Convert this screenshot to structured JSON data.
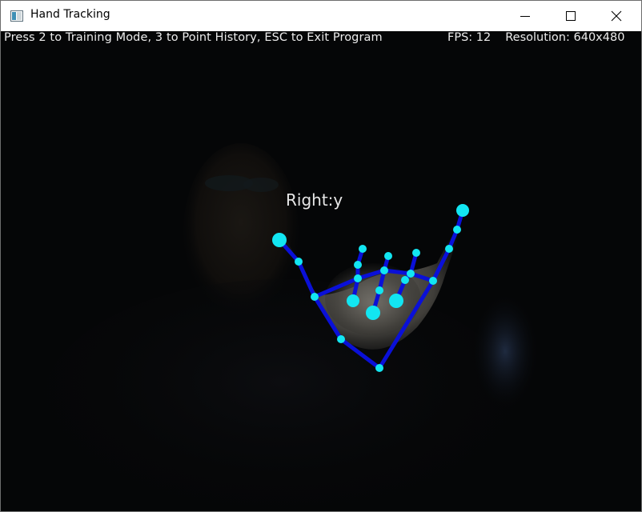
{
  "window": {
    "title": "Hand Tracking",
    "controls": [
      "minimize",
      "maximize",
      "close"
    ]
  },
  "hud": {
    "instructions": "Press 2 to Training Mode, 3 to Point History, ESC to Exit Program",
    "fps_label": "FPS: 12",
    "resolution_label": "Resolution: 640x480"
  },
  "detection": {
    "hand_label": "Right:y"
  },
  "icons": {
    "app": "app-window-icon",
    "minimize": "minimize-icon",
    "maximize": "maximize-icon",
    "close": "close-icon"
  },
  "colors": {
    "skeleton_line": "#0a10d8",
    "landmark": "#12e6f2",
    "background": "#050607"
  }
}
